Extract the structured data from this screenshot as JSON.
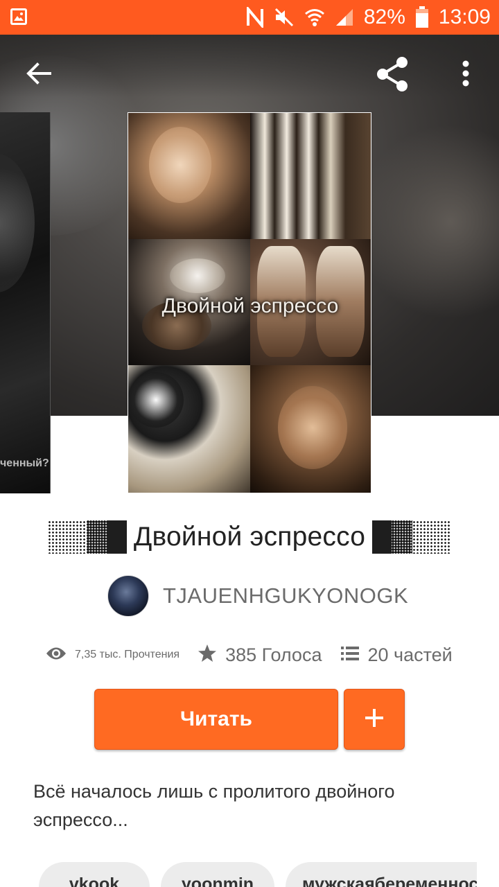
{
  "status_bar": {
    "battery": "82%",
    "time": "13:09"
  },
  "book": {
    "cover_title": "Двойной эспрессо",
    "side_cover_caption": "ченный?",
    "title": "Двойной эспрессо",
    "author": "TJAUENHGUKYONOGK",
    "stats": {
      "reads": "7,35 тыс. Прочтения",
      "votes": "385 Голоса",
      "parts": "20 частей"
    },
    "read_button": "Читать",
    "description": "Всё началось лишь с пролитого двойного эспрессо...",
    "tags": [
      "vkook",
      "yoonmin",
      "мужскаябеременность"
    ]
  },
  "colors": {
    "accent": "#ff6a22",
    "status_bar": "#ff5a1f"
  },
  "icons": [
    "image-notification-icon",
    "nfc-icon",
    "mute-icon",
    "wifi-icon",
    "signal-icon",
    "battery-icon",
    "back-arrow-icon",
    "share-icon",
    "more-vert-icon",
    "eye-icon",
    "star-icon",
    "list-icon",
    "plus-icon"
  ]
}
